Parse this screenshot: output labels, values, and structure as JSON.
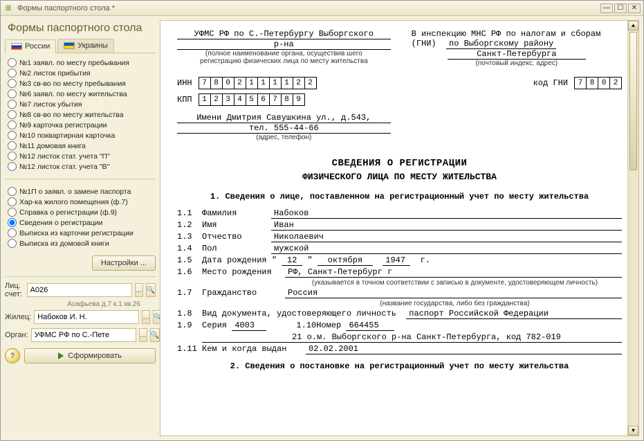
{
  "window": {
    "title": "Формы паспортного стола *"
  },
  "sidebar": {
    "heading": "Формы паспортного стола",
    "tabs": [
      {
        "label": "России",
        "flag": "ru",
        "active": true
      },
      {
        "label": "Украины",
        "flag": "ua",
        "active": false
      }
    ],
    "group1": [
      "№1 заявл. по месту пребывания",
      "№2 листок прибытия",
      "№3 св-во по месту пребывания",
      "№6 заявл. по месту жительства",
      "№7 листок убытия",
      "№8 св-во по месту жительства",
      "№9 карточка регистрации",
      "№10 поквартирная карточка",
      "№11 домовая книга",
      "№12 листок стат. учета \"П\"",
      "№12 листок стат. учета \"В\""
    ],
    "group2": [
      "№1П о заявл. о замене паспорта",
      "Хар-ка жилого помещения (ф.7)",
      "Справка о регистрации (ф.9)",
      "Сведения о регистрации",
      "Выписка из карточки регистрации",
      "Выписка из домовой книги"
    ],
    "selected": "Сведения о регистрации",
    "settings_btn": "Настройки ...",
    "acct_label": "Лиц. счет:",
    "acct_value": "A026",
    "acct_hint": "Асафьева д.7 к.1 кв.26",
    "resident_label": "Жилец:",
    "resident_value": "Набоков И. Н.",
    "organ_label": "Орган:",
    "organ_value": "УФМС РФ по С.-Пете",
    "form_btn": "Сформировать"
  },
  "doc": {
    "org_line1": "УФМС РФ по С.-Петербургу Выборгского",
    "org_line2": "р-на",
    "org_caption1": "(полное наименование органа, осуществив шего",
    "org_caption2": "регистрацию физических лица по месту жительства",
    "insp_line1": "В инспекцию МНС РФ по налогам и сборам",
    "insp_line2_a": "(ГНИ)",
    "insp_line2_b": "по Выборгскому району",
    "insp_line3": "Санкт-Петербурга",
    "insp_caption": "(почтовый индекс, адрес)",
    "inn_label": "ИНН",
    "inn": [
      "7",
      "8",
      "0",
      "2",
      "1",
      "1",
      "1",
      "1",
      "2",
      "2"
    ],
    "kpp_label": "КПП",
    "kpp": [
      "1",
      "2",
      "3",
      "4",
      "5",
      "6",
      "7",
      "8",
      "9"
    ],
    "gni_label": "код ГНИ",
    "gni": [
      "7",
      "8",
      "0",
      "2"
    ],
    "addr_line1": "Имени Дмитрия Савушкина ул., д.543,",
    "addr_line2": "тел. 555-44-66",
    "addr_caption": "(адрес, телефон)",
    "title1": "СВЕДЕНИЯ О РЕГИСТРАЦИИ",
    "title2": "ФИЗИЧЕСКОГО ЛИЦА ПО МЕСТУ ЖИТЕЛЬСТВА",
    "sec1": "1. Сведения о лице, поставленном на регистрационный учет по месту жительства",
    "f11_lbl": "Фамилия",
    "f11_val": "Набоков",
    "f12_lbl": "Имя",
    "f12_val": "Иван",
    "f13_lbl": "Отчество",
    "f13_val": "Николаевич",
    "f14_lbl": "Пол",
    "f14_val": "мужской",
    "f15_lbl": "Дата рождения \"",
    "f15_d": "12",
    "f15_m": "октября",
    "f15_y": "1947",
    "f15_suf": "г.",
    "f16_lbl": "Место рождения",
    "f16_val": "РФ, Санкт-Петербург г",
    "f16_cap": "(указывается в точном соответствии с записью в документе, удостоверяющем личность)",
    "f17_lbl": "Гражданство",
    "f17_val": "Россия",
    "f17_cap": "(название государства, либо без гражданства)",
    "f18_lbl": "Вид документа, удостоверяющего личность",
    "f18_val": "паспорт Российской Федерации",
    "f19_lbl": "Серия",
    "f19_val": "4003",
    "f110_lbl": "Номер",
    "f110_val": "664455",
    "f19b": "21 о.м. Выборгского р-на Санкт-Петербурга, код 782-019",
    "f111_lbl": "Кем и когда выдан",
    "f111_val": "02.02.2001",
    "sec2": "2. Сведения о постановке на регистрационный учет по месту жительства"
  }
}
